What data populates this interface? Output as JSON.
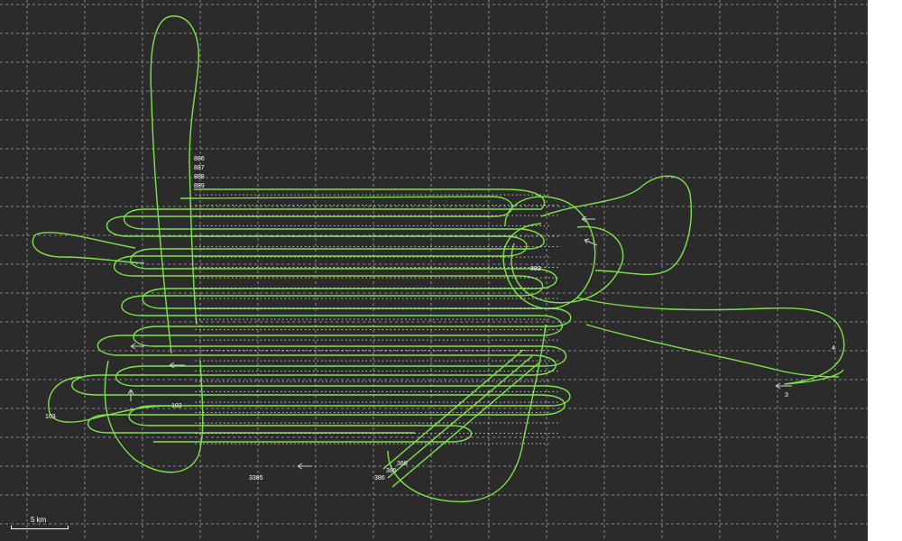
{
  "map": {
    "background_color": "#2b2b2b",
    "track_color": "#7ee24a",
    "grid_color": "#8a8a8a",
    "scale_label": "5 km"
  },
  "waypoint_labels": [
    "102",
    "103",
    "3385",
    "4",
    "3",
    "883",
    "386",
    "385",
    "386"
  ],
  "row_labels": [
    "886",
    "887",
    "888",
    "889"
  ]
}
